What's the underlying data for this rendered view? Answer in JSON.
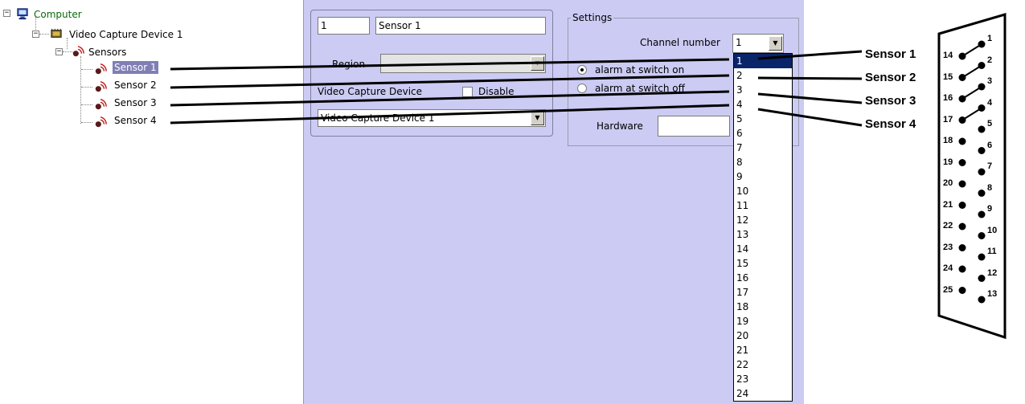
{
  "tree": {
    "root": "Computer",
    "device": "Video Capture Device 1",
    "group": "Sensors",
    "items": [
      "Sensor 1",
      "Sensor 2",
      "Sensor 3",
      "Sensor 4"
    ],
    "selected_index": 0
  },
  "form": {
    "id_value": "1",
    "name_value": "Sensor 1",
    "region_label": "Region",
    "region_value": "",
    "device_label": "Video Capture Device",
    "disable_label": "Disable",
    "device_value": "Video Capture Device 1",
    "settings": {
      "title": "Settings",
      "channel_label": "Channel number",
      "channel_value": "1",
      "alarm_on_label": "alarm at switch on",
      "alarm_off_label": "alarm at switch off",
      "hardware_label": "Hardware",
      "hardware_value": ""
    },
    "channel_options": [
      "1",
      "2",
      "3",
      "4",
      "5",
      "6",
      "7",
      "8",
      "9",
      "10",
      "11",
      "12",
      "13",
      "14",
      "15",
      "16",
      "17",
      "18",
      "19",
      "20",
      "21",
      "22",
      "23",
      "24"
    ]
  },
  "connector": {
    "sensor_labels": [
      "Sensor 1",
      "Sensor 2",
      "Sensor 3",
      "Sensor 4"
    ],
    "right_pins": [
      "1",
      "2",
      "3",
      "4",
      "5",
      "6",
      "7",
      "8",
      "9",
      "10",
      "11",
      "12",
      "13"
    ],
    "left_pins": [
      "14",
      "15",
      "16",
      "17",
      "18",
      "19",
      "20",
      "21",
      "22",
      "23",
      "24",
      "25"
    ]
  },
  "icons": {
    "computer": "computer-icon",
    "device": "capture-device-icon",
    "sensor": "sensor-icon"
  }
}
